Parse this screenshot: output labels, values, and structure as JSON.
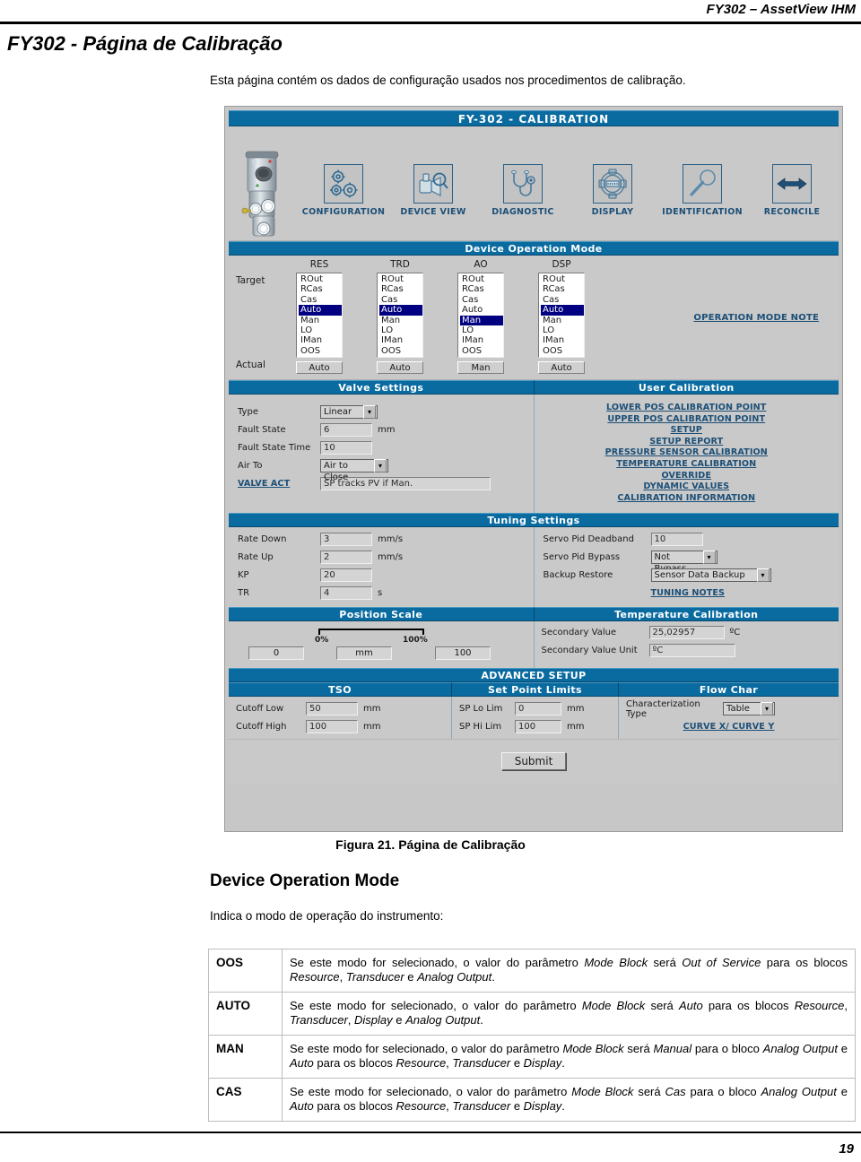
{
  "running_head": "FY302 – AssetView IHM",
  "doc_title": "FY302 - Página de Calibração",
  "intro": "Esta página contém os dados de configuração usados nos procedimentos de calibração.",
  "figure_caption": "Figura 21. Página de Calibração",
  "page_number": "19",
  "section": {
    "title": "Device Operation Mode",
    "intro": "Indica o modo de operação do instrumento:"
  },
  "app": {
    "title": "FY-302 - CALIBRATION",
    "nav": [
      {
        "label": "CONFIGURATION",
        "icon": "gears-icon"
      },
      {
        "label": "DEVICE VIEW",
        "icon": "valve-magnifier-icon"
      },
      {
        "label": "DIAGNOSTIC",
        "icon": "stethoscope-icon"
      },
      {
        "label": "DISPLAY",
        "icon": "display-gauge-icon"
      },
      {
        "label": "IDENTIFICATION",
        "icon": "magnifier-icon"
      },
      {
        "label": "RECONCILE",
        "icon": "double-arrow-icon"
      }
    ],
    "device_photo_alt": "fy302-valve-positioner-photo",
    "operation_mode": {
      "header": "Device Operation Mode",
      "target_label": "Target",
      "actual_label": "Actual",
      "note_link": "OPERATION MODE NOTE",
      "options": [
        "ROut",
        "RCas",
        "Cas",
        "Auto",
        "Man",
        "LO",
        "IMan",
        "OOS"
      ],
      "columns": [
        {
          "name": "RES",
          "selected": "Auto",
          "actual": "Auto"
        },
        {
          "name": "TRD",
          "selected": "Auto",
          "actual": "Auto"
        },
        {
          "name": "AO",
          "selected": "Man",
          "actual": "Man"
        },
        {
          "name": "DSP",
          "selected": "Auto",
          "actual": "Auto"
        }
      ]
    },
    "valve_settings": {
      "header": "Valve Settings",
      "fields": [
        {
          "label": "Type",
          "value": "Linear",
          "unit": "",
          "kind": "select"
        },
        {
          "label": "Fault State",
          "value": "6",
          "unit": "mm",
          "kind": "input"
        },
        {
          "label": "Fault State Time",
          "value": "10",
          "unit": "",
          "kind": "input"
        },
        {
          "label": "Air To",
          "value": "Air to Close",
          "unit": "",
          "kind": "select"
        }
      ],
      "valve_act_link": "VALVE ACT",
      "valve_act_value": "SP tracks PV if Man."
    },
    "user_calibration": {
      "header": "User Calibration",
      "links": [
        "LOWER POS CALIBRATION POINT",
        "UPPER POS CALIBRATION POINT",
        "SETUP",
        "SETUP REPORT",
        "PRESSURE SENSOR CALIBRATION",
        "TEMPERATURE CALIBRATION",
        "OVERRIDE",
        "DYNAMIC VALUES",
        "CALIBRATION INFORMATION"
      ]
    },
    "tuning_settings": {
      "header": "Tuning Settings",
      "left_fields": [
        {
          "label": "Rate Down",
          "value": "3",
          "unit": "mm/s",
          "kind": "input"
        },
        {
          "label": "Rate Up",
          "value": "2",
          "unit": "mm/s",
          "kind": "input"
        },
        {
          "label": "KP",
          "value": "20",
          "unit": "",
          "kind": "input"
        },
        {
          "label": "TR",
          "value": "4",
          "unit": "s",
          "kind": "input"
        }
      ],
      "right_fields": [
        {
          "label": "Servo Pid Deadband",
          "value": "10",
          "unit": "",
          "kind": "input"
        },
        {
          "label": "Servo Pid Bypass",
          "value": "Not Bypass",
          "unit": "",
          "kind": "select"
        },
        {
          "label": "Backup Restore",
          "value": "Sensor Data Backup",
          "unit": "",
          "kind": "select"
        }
      ],
      "notes_link": "TUNING NOTES"
    },
    "position_scale": {
      "header": "Position Scale",
      "min_value": "0",
      "unit_value": "mm",
      "max_value": "100",
      "tick_low": "0%",
      "tick_high": "100%"
    },
    "temperature_calibration": {
      "header": "Temperature Calibration",
      "fields": [
        {
          "label": "Secondary Value",
          "value": "25,02957",
          "unit": "ºC"
        },
        {
          "label": "Secondary Value Unit",
          "value": "ºC",
          "unit": ""
        }
      ]
    },
    "advanced_setup": {
      "header": "ADVANCED SETUP",
      "tso": {
        "header": "TSO",
        "fields": [
          {
            "label": "Cutoff Low",
            "value": "50",
            "unit": "mm"
          },
          {
            "label": "Cutoff High",
            "value": "100",
            "unit": "mm"
          }
        ]
      },
      "set_point_limits": {
        "header": "Set Point Limits",
        "fields": [
          {
            "label": "SP Lo Lim",
            "value": "0",
            "unit": "mm"
          },
          {
            "label": "SP Hi Lim",
            "value": "100",
            "unit": "mm"
          }
        ]
      },
      "flow_char": {
        "header": "Flow Char",
        "field": {
          "label": "Characterization Type",
          "value": "Table"
        },
        "curve_link": "CURVE X/ CURVE Y"
      }
    },
    "submit_label": "Submit"
  },
  "mode_table": [
    {
      "key": "OOS",
      "html": "Se este modo for selecionado, o valor do parâmetro <i>Mode Block</i> será <i>Out of Service</i> para os blocos <i>Resource</i>, <i>Transducer</i> e <i>Analog Output</i>."
    },
    {
      "key": "AUTO",
      "html": "Se este modo for selecionado, o valor do parâmetro <i>Mode Block</i> será <i>Auto</i> para os blocos <i>Resource</i>, <i>Transducer</i>, <i>Display</i> e <i>Analog Output</i>."
    },
    {
      "key": "MAN",
      "html": "Se este modo for selecionado, o valor do parâmetro <i>Mode Block</i> será <i>Manual</i> para o bloco <i>Analog Output</i> e <i>Auto</i> para os blocos <i>Resource</i>, <i>Transducer</i> e <i>Display</i>."
    },
    {
      "key": "CAS",
      "html": "Se este modo for selecionado, o valor do parâmetro <i>Mode Block</i> será <i>Cas</i> para o bloco <i>Analog Output</i> e <i>Auto</i> para os blocos <i>Resource</i>, <i>Transducer</i> e <i>Display</i>."
    }
  ],
  "colors": {
    "header_blue": "#0a6ba0",
    "link_blue": "#1c4f77",
    "selection_navy": "#000080",
    "panel_gray": "#c9c9c9"
  }
}
